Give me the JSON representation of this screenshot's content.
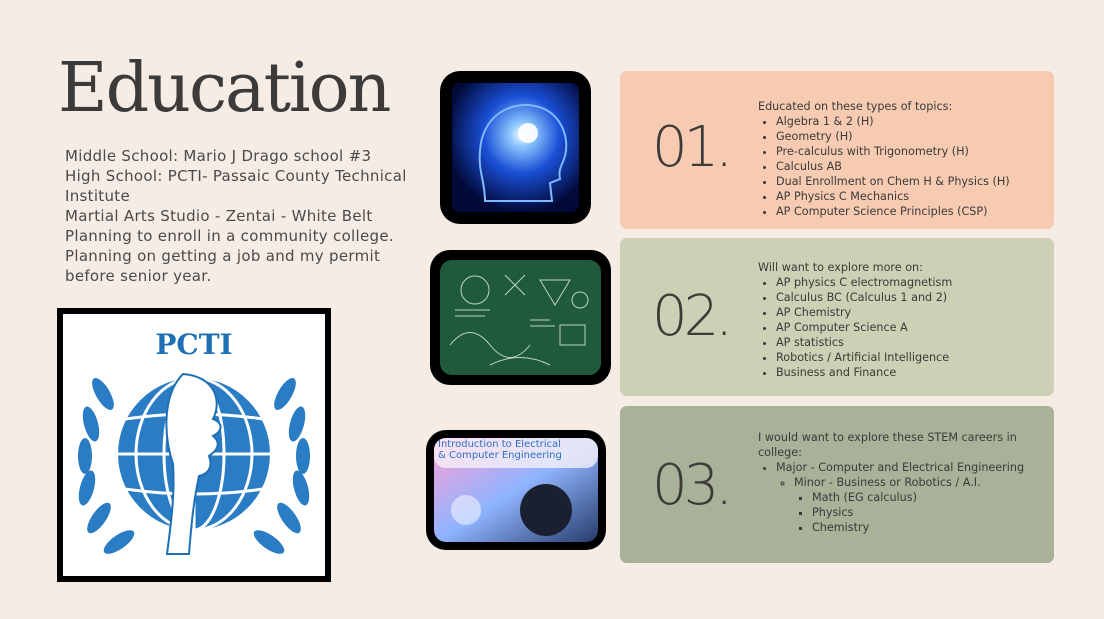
{
  "slide": {
    "title": "Education",
    "about_lines": [
      "Middle School: Mario J Drago school #3",
      "High School: PCTI- Passaic County Technical Institute",
      "Martial Arts Studio - Zentai - White Belt",
      "Planning to enroll in a community college.",
      "Planning on getting a job and my permit before senior year."
    ],
    "logo_text": "PCTI",
    "thumb3_caption_line1": "Introduction to Electrical",
    "thumb3_caption_line2": "& Computer Engineering"
  },
  "cards": [
    {
      "number": "01.",
      "heading": "Educated on these types of topics:",
      "items": [
        "Algebra 1 & 2 (H)",
        "Geometry (H)",
        "Pre-calculus with Trigonometry (H)",
        "Calculus AB",
        "Dual Enrollment on Chem H & Physics (H)",
        "AP Physics C Mechanics",
        "AP Computer Science Principles (CSP)"
      ],
      "color": "#f6cbb2"
    },
    {
      "number": "02.",
      "heading": "Will want to explore more on:",
      "items": [
        "AP physics C electromagnetism",
        "Calculus BC (Calculus 1 and 2)",
        "AP Chemistry",
        "AP Computer Science A",
        "AP statistics",
        "Robotics / Artificial Intelligence",
        "Business and Finance"
      ],
      "color": "#cdd0b4"
    },
    {
      "number": "03.",
      "heading": "I would want to explore these STEM careers in college:",
      "major": "Major - Computer and Electrical Engineering",
      "minor": "Minor -  Business or Robotics / A.I.",
      "subitems": [
        "Math (EG calculus)",
        "Physics",
        "Chemistry"
      ],
      "color": "#a7b298"
    }
  ]
}
